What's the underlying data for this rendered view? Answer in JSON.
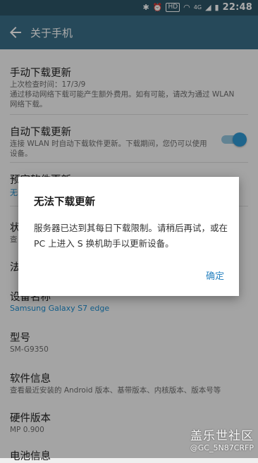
{
  "status_bar": {
    "hd": "HD",
    "network": "4G",
    "time": "22:48"
  },
  "app_bar": {
    "title": "关于手机"
  },
  "items": [
    {
      "title": "手动下载更新",
      "sub1": "上次检查时间：17/3/9",
      "sub2": "通过移动网络下载可能产生额外费用。如有可能，请改为通过 WLAN",
      "sub3": "网络下载。"
    },
    {
      "title": "自动下载更新",
      "sub1": "连接 WLAN 时自动下载软件更新。下载期间，您仍可以使用",
      "sub2": "设备。",
      "toggle_on": true
    },
    {
      "title": "预定软件更新",
      "sub": "无"
    },
    {
      "title": "状态",
      "sub": "查"
    },
    {
      "title": "法"
    },
    {
      "title": "设备名称",
      "sub": "Samsung Galaxy S7 edge"
    },
    {
      "title": "型号",
      "sub": "SM-G9350"
    },
    {
      "title": "软件信息",
      "sub": "查看最近安装的 Android 版本、基带版本、内核版本、版本号等"
    },
    {
      "title": "硬件版本",
      "sub": "MP 0.900"
    },
    {
      "title": "电池信息"
    }
  ],
  "dialog": {
    "title": "无法下载更新",
    "message": "服务器已达到其每日下载限制。请稍后再试，或在 PC 上进入 S 换机助手以更新设备。",
    "button": "确定"
  },
  "watermark": {
    "line1": "盖乐世社区",
    "line2": "@GC_5N87CRFP"
  },
  "colors": {
    "status_bar": "#2c5466",
    "app_bar": "#3a6e86",
    "accent": "#1d8ccd",
    "dialog_button": "#2a83c0"
  }
}
